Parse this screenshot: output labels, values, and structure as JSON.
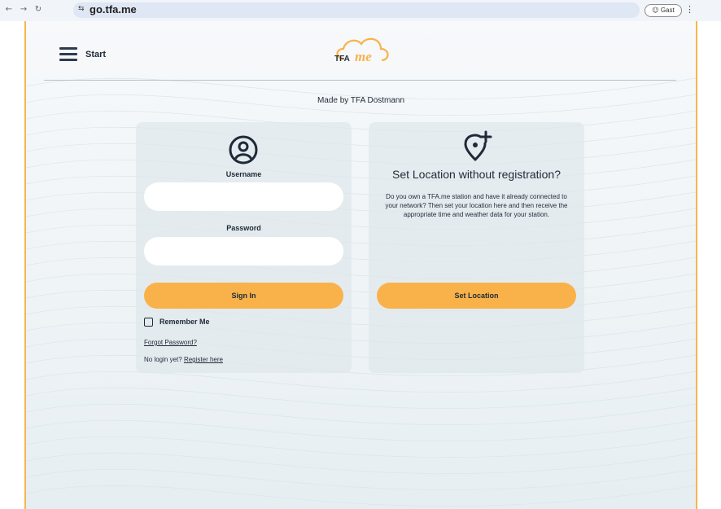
{
  "browser": {
    "back_icon": "←",
    "forward_icon": "→",
    "reload_icon": "↻",
    "tune_icon": "⇆",
    "url": "go.tfa.me",
    "guest_label": "Gast",
    "menu_icon": "⋮"
  },
  "header": {
    "menu_label": "Start",
    "logo_text_tfa": "TFA",
    "logo_text_me": "me"
  },
  "tagline": "Made by TFA Dostmann",
  "login": {
    "username_label": "Username",
    "username_value": "",
    "password_label": "Password",
    "password_value": "",
    "sign_in_label": "Sign In",
    "remember_label": "Remember Me",
    "remember_checked": false,
    "forgot_label": "Forgot Password?",
    "no_login_text": "No login yet?",
    "register_label": "Register here"
  },
  "location": {
    "title": "Set Location without registration?",
    "description": "Do you own a TFA.me station and have it already connected to your network? Then set your location here and then receive the appropriate time and weather data for your station.",
    "button_label": "Set Location"
  },
  "colors": {
    "accent": "#f9b24a",
    "text": "#1f2a37",
    "frame": "#f7b54c"
  }
}
